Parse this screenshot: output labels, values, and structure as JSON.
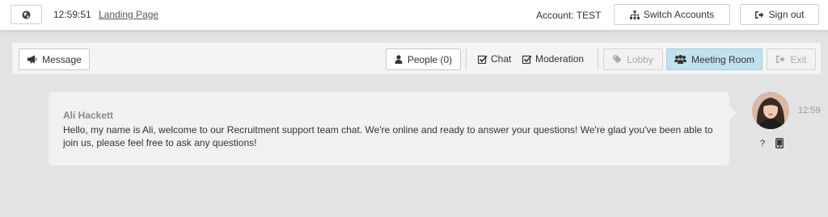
{
  "header": {
    "time": "12:59:51",
    "landing_link": "Landing Page",
    "account_label": "Account: TEST",
    "switch_accounts": "Switch Accounts",
    "sign_out": "Sign out",
    "globe_icon": "globe-icon",
    "sitemap_icon": "sitemap-icon",
    "signout_icon": "sign-out-icon"
  },
  "toolbar": {
    "message": "Message",
    "people": "People (0)",
    "chat": "Chat",
    "moderation": "Moderation",
    "lobby": "Lobby",
    "meeting_room": "Meeting Room",
    "exit": "Exit",
    "meeting_room_active_color": "#bfe2ee"
  },
  "chat": {
    "messages": [
      {
        "sender": "Ali Hackett",
        "text": "Hello, my name is Ali, welcome to our Recruitment support team chat. We're online and ready to answer your questions! We're glad you've been able to join us, please feel free to ask any questions!",
        "time": "12:59",
        "help": "?"
      }
    ]
  }
}
